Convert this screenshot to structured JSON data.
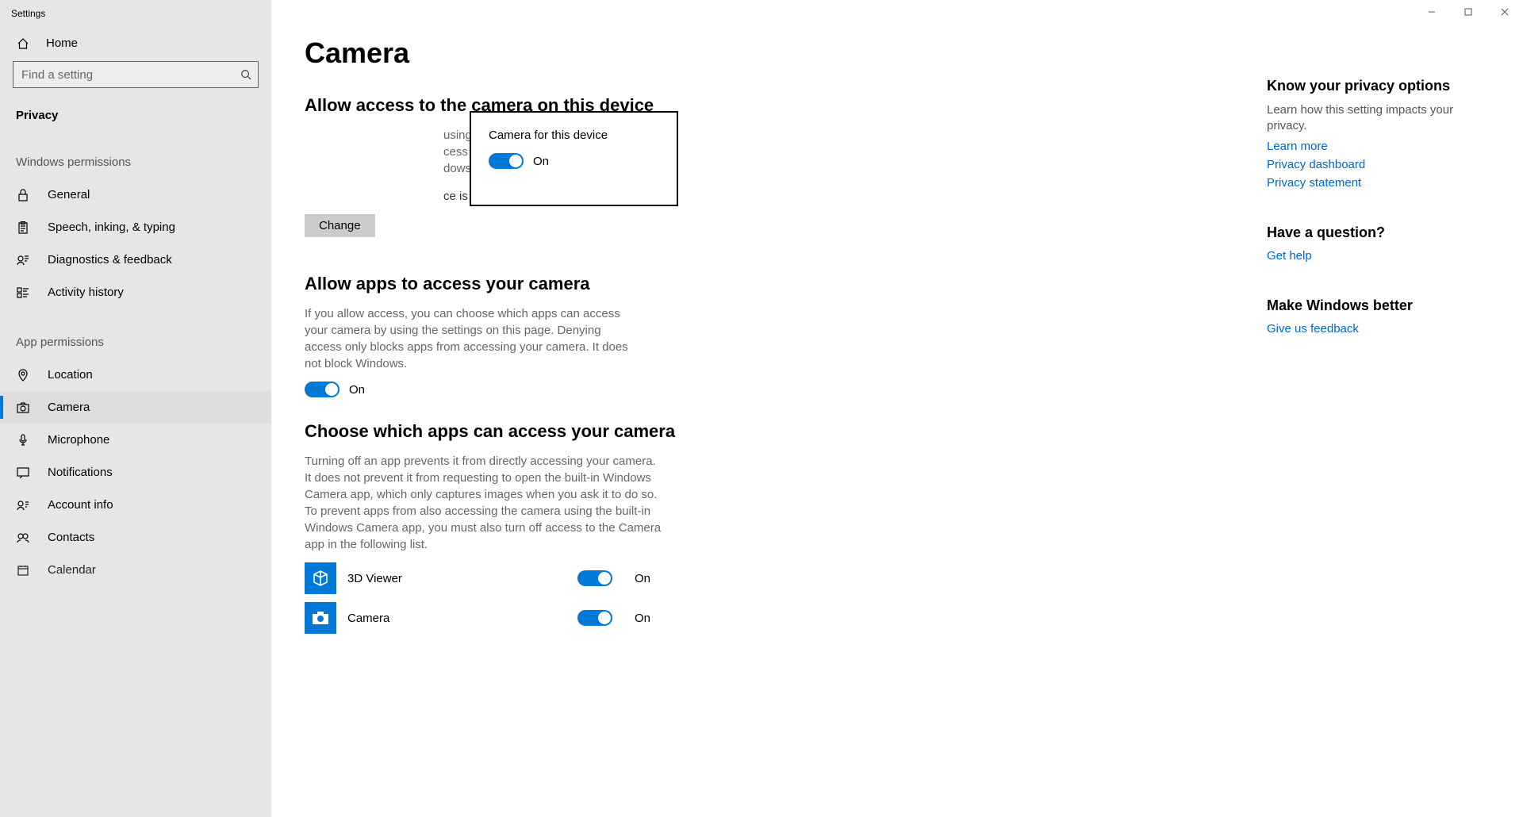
{
  "window": {
    "title": "Settings"
  },
  "sidebar": {
    "home": "Home",
    "search_placeholder": "Find a setting",
    "category": "Privacy",
    "group_windows": "Windows permissions",
    "group_app": "App permissions",
    "win_items": [
      {
        "label": "General"
      },
      {
        "label": "Speech, inking, & typing"
      },
      {
        "label": "Diagnostics & feedback"
      },
      {
        "label": "Activity history"
      }
    ],
    "app_items": [
      {
        "label": "Location"
      },
      {
        "label": "Camera"
      },
      {
        "label": "Microphone"
      },
      {
        "label": "Notifications"
      },
      {
        "label": "Account info"
      },
      {
        "label": "Contacts"
      },
      {
        "label": "Calendar"
      }
    ]
  },
  "page": {
    "title": "Camera",
    "section1": {
      "heading": "Allow access to the camera on this device",
      "body_visible_tail": "using this device will be able to choose\ncess by using the settings on this page.\ndows and apps from accessing the",
      "status": "ce is on",
      "change_btn": "Change"
    },
    "section2": {
      "heading": "Allow apps to access your camera",
      "body": "If you allow access, you can choose which apps can access your camera by using the settings on this page. Denying access only blocks apps from accessing your camera. It does not block Windows.",
      "toggle_state": "On"
    },
    "section3": {
      "heading": "Choose which apps can access your camera",
      "body": "Turning off an app prevents it from directly accessing your camera. It does not prevent it from requesting to open the built-in Windows Camera app, which only captures images when you ask it to do so. To prevent apps from also accessing the camera using the built-in Windows Camera app, you must also turn off access to the Camera app in the following list.",
      "apps": [
        {
          "name": "3D Viewer",
          "state": "On"
        },
        {
          "name": "Camera",
          "state": "On"
        }
      ]
    }
  },
  "popup": {
    "title": "Camera for this device",
    "state": "On"
  },
  "rail": {
    "privacy_head": "Know your privacy options",
    "privacy_text": "Learn how this setting impacts your privacy.",
    "learn_more": "Learn more",
    "dashboard": "Privacy dashboard",
    "statement": "Privacy statement",
    "question_head": "Have a question?",
    "get_help": "Get help",
    "better_head": "Make Windows better",
    "feedback": "Give us feedback"
  }
}
